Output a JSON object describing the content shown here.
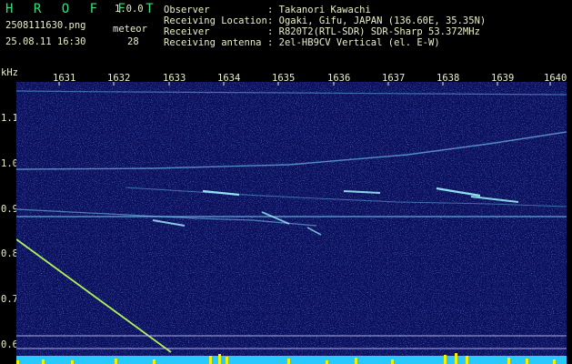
{
  "header": {
    "app_name": "H R O F F T",
    "version": "1.0.0",
    "filename": "2508111630.png",
    "datetime": "25.08.11 16:30",
    "meteor_label": "meteor",
    "meteor_count": "28",
    "observer_label": "Observer",
    "observer_value": ": Takanori Kawachi",
    "location_label": "Receiving Location",
    "location_value": ": Ogaki, Gifu, JAPAN (136.60E, 35.35N)",
    "receiver_label": "Receiver",
    "receiver_value": ": R820T2(RTL-SDR) SDR-Sharp 53.372MHz",
    "antenna_label": "Receiving antenna",
    "antenna_value": ": 2el-HB9CV Vertical (el. E-W)"
  },
  "axes": {
    "y_unit": "kHz",
    "y_ticks": [
      "1.1",
      "1.0",
      "0.9",
      "0.8",
      "0.7",
      "0.6"
    ],
    "x_ticks": [
      "1631",
      "1632",
      "1633",
      "1634",
      "1635",
      "1636",
      "1637",
      "1638",
      "1639",
      "1640"
    ]
  },
  "colors": {
    "background": "#0a0f5c",
    "noise": "#2431a8",
    "trace": "#7fd6ff",
    "echo": "#9ff7ff",
    "meteor_trail": "#b9ff5a",
    "bottom_level": "#27c9ff",
    "bottom_peak": "#f3f000",
    "ref_line": "#c9c9ff",
    "header_text": "#e8f0c8",
    "brand": "#39e07a"
  }
}
